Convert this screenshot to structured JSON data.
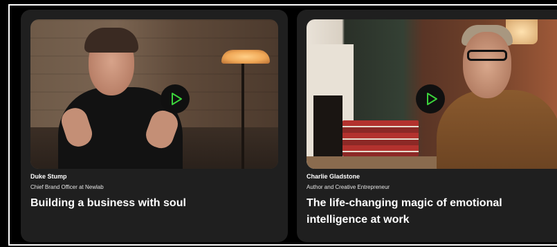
{
  "colors": {
    "background": "#000000",
    "card": "#1f1f1f",
    "play_accent": "#3bd23b",
    "text": "#ffffff"
  },
  "cards": [
    {
      "speaker_name": "Duke Stump",
      "speaker_role": "Chief Brand Officer at Newlab",
      "title": "Building a business with soul",
      "play_icon": "play-icon"
    },
    {
      "speaker_name": "Charlie Gladstone",
      "speaker_role": "Author and Creative Entrepreneur",
      "title": "The life-changing magic of emotional intelligence at work",
      "play_icon": "play-icon"
    }
  ]
}
